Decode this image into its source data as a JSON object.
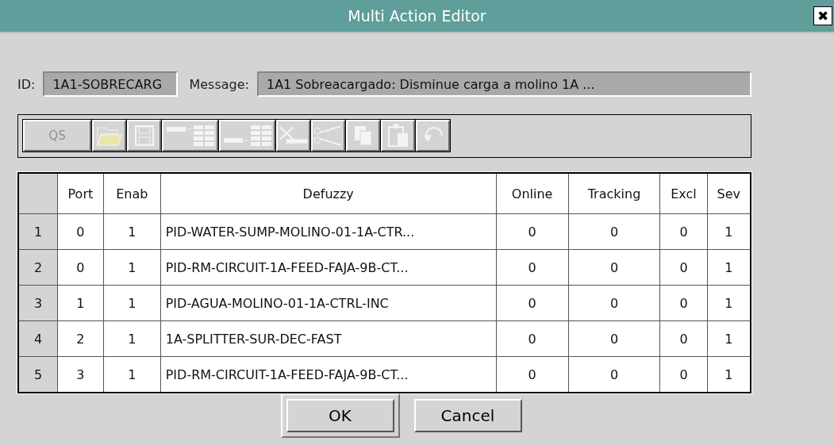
{
  "window": {
    "title": "Multi Action Editor",
    "close": "✖"
  },
  "id_field": {
    "label": "ID:",
    "value": "1A1-SOBRECARG"
  },
  "message_field": {
    "label": "Message:",
    "value": "1A1 Sobreacargado: Disminue carga a molino 1A ..."
  },
  "toolbar": [
    {
      "kind": "text",
      "label": "QS",
      "disabled": true
    },
    {
      "kind": "open",
      "disabled": true
    },
    {
      "kind": "save",
      "disabled": true
    },
    {
      "kind": "insert-before",
      "disabled": true
    },
    {
      "kind": "insert-after",
      "disabled": true
    },
    {
      "kind": "delete",
      "disabled": true
    },
    {
      "kind": "cut",
      "disabled": true
    },
    {
      "kind": "copy",
      "disabled": true
    },
    {
      "kind": "paste",
      "disabled": true
    },
    {
      "kind": "undo",
      "disabled": true
    }
  ],
  "table": {
    "columns": [
      "Port",
      "Enab",
      "Defuzzy",
      "Online",
      "Tracking",
      "Excl",
      "Sev"
    ],
    "rows": [
      {
        "index": "1",
        "cells": [
          "0",
          "1",
          "PID-WATER-SUMP-MOLINO-01-1A-CTR...",
          "0",
          "0",
          "0",
          "1"
        ]
      },
      {
        "index": "2",
        "cells": [
          "0",
          "1",
          "PID-RM-CIRCUIT-1A-FEED-FAJA-9B-CT...",
          "0",
          "0",
          "0",
          "1"
        ]
      },
      {
        "index": "3",
        "cells": [
          "1",
          "1",
          "PID-AGUA-MOLINO-01-1A-CTRL-INC",
          "0",
          "0",
          "0",
          "1"
        ]
      },
      {
        "index": "4",
        "cells": [
          "2",
          "1",
          "1A-SPLITTER-SUR-DEC-FAST",
          "0",
          "0",
          "0",
          "1"
        ]
      },
      {
        "index": "5",
        "cells": [
          "3",
          "1",
          "PID-RM-CIRCUIT-1A-FEED-FAJA-9B-CT...",
          "0",
          "0",
          "0",
          "1"
        ]
      }
    ]
  },
  "buttons": [
    {
      "label": "OK",
      "default": true
    },
    {
      "label": "Cancel",
      "default": false
    }
  ]
}
